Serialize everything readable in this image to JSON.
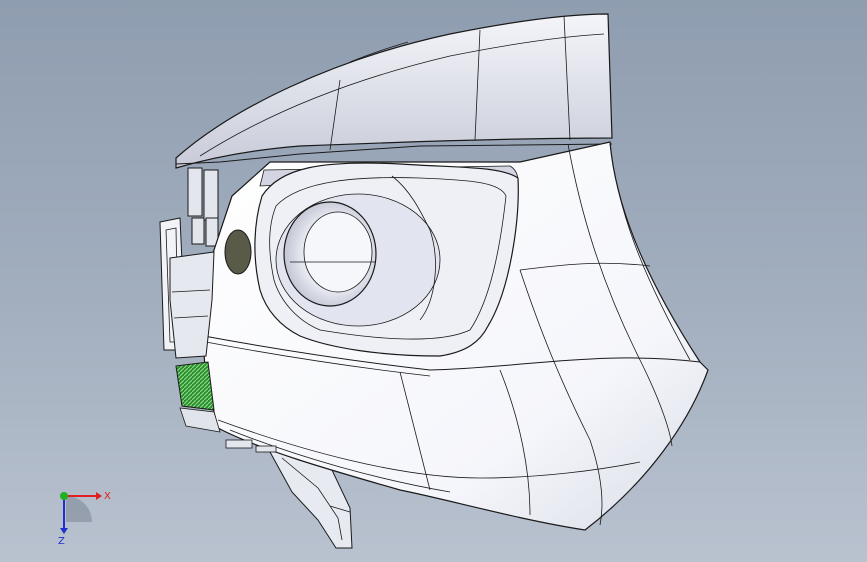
{
  "viewport": {
    "background_top": "#8f9db0",
    "background_bottom": "#b9c2cf",
    "model_fill": "#ffffff",
    "model_edge": "#1a1a1a",
    "shade_fill": "#c9ccd8",
    "inner_shade": "#d8dbe6",
    "grille_mesh_color": "#3aa33a",
    "sensor_cap_color": "#5a5a48"
  },
  "triad": {
    "x_label": "X",
    "z_label": "Z",
    "x_color": "#e02020",
    "y_color": "#20b020",
    "z_color": "#2030d0"
  }
}
